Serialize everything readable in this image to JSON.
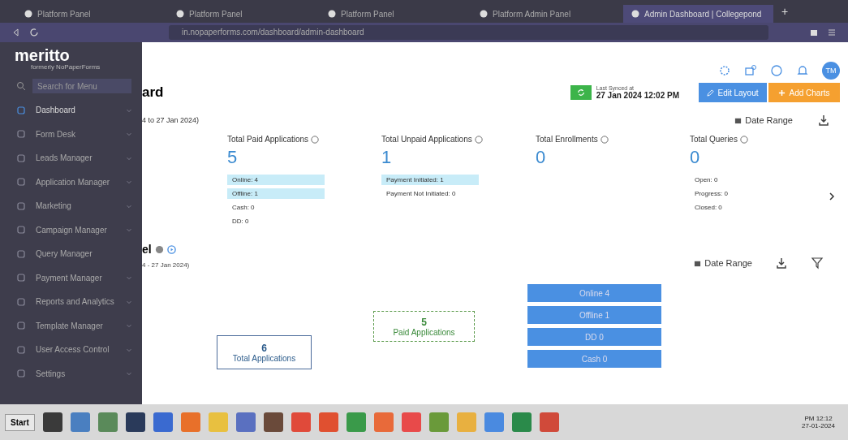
{
  "browser": {
    "tabs": [
      {
        "title": "Platform Panel",
        "selected": false
      },
      {
        "title": "Platform Panel",
        "selected": false
      },
      {
        "title": "Platform Panel",
        "selected": false
      },
      {
        "title": "Platform Admin Panel",
        "selected": false
      },
      {
        "title": "Admin Dashboard | Collegepond",
        "selected": true
      }
    ],
    "new_tab": "+",
    "url": "in.nopaperforms.com/dashboard/admin-dashboard"
  },
  "sidebar": {
    "logo": "meritto",
    "tagline": "formerly NoPaperForms",
    "search": {
      "placeholder": "Search for Menu"
    },
    "items": [
      {
        "label": "Dashboard",
        "selected": true,
        "has_submenu": true
      },
      {
        "label": "Form Desk",
        "selected": false,
        "has_submenu": true
      },
      {
        "label": "Leads Manager",
        "selected": false,
        "has_submenu": true
      },
      {
        "label": "Application Manager",
        "selected": false,
        "has_submenu": true
      },
      {
        "label": "Marketing",
        "selected": false,
        "has_submenu": true
      },
      {
        "label": "Campaign Manager",
        "selected": false,
        "has_submenu": true
      },
      {
        "label": "Query Manager",
        "selected": false,
        "has_submenu": false
      },
      {
        "label": "Payment Manager",
        "selected": false,
        "has_submenu": true
      },
      {
        "label": "Reports and Analytics",
        "selected": false,
        "has_submenu": true
      },
      {
        "label": "Template Manager",
        "selected": false,
        "has_submenu": true
      },
      {
        "label": "User Access Control",
        "selected": false,
        "has_submenu": true
      },
      {
        "label": "Settings",
        "selected": false,
        "has_submenu": true
      }
    ]
  },
  "header": {
    "avatar": "TM",
    "title": "ard",
    "last_synced_label": "Last Synced at",
    "last_synced": "27 Jan 2024 12:02 PM",
    "edit_layout": "Edit Layout",
    "add_charts": "Add Charts"
  },
  "summary": {
    "period": "4 to 27 Jan 2024)",
    "date_range": "Date Range",
    "cards": [
      {
        "title": "Total Paid Applications",
        "value": "5",
        "lines": [
          {
            "text": "Online: 4",
            "highlighted": true
          },
          {
            "text": "Offline: 1",
            "highlighted": true
          },
          {
            "text": "Cash: 0",
            "highlighted": false
          },
          {
            "text": "DD: 0",
            "highlighted": false
          }
        ]
      },
      {
        "title": "Total Unpaid Applications",
        "value": "1",
        "lines": [
          {
            "text": "Payment Initiated: 1",
            "highlighted": true
          },
          {
            "text": "Payment Not Initiated: 0",
            "highlighted": false
          }
        ]
      },
      {
        "title": "Total Enrollments",
        "value": "0"
      },
      {
        "title": "Total Queries",
        "value": "0",
        "lines": [
          {
            "text": "Open: 0",
            "highlighted": false
          },
          {
            "text": "Progress: 0",
            "highlighted": false
          },
          {
            "text": "Closed: 0",
            "highlighted": false
          }
        ]
      }
    ]
  },
  "funnel": {
    "title": "el",
    "period": "4 - 27 Jan 2024)",
    "date_range": "Date Range",
    "total": {
      "value": "6",
      "label": "Total Applications"
    },
    "paid": {
      "value": "5",
      "label": "Paid Applications"
    },
    "modes": [
      "Online 4",
      "Offline 1",
      "DD 0",
      "Cash 0"
    ]
  },
  "taskbar": {
    "start": "Start",
    "apps": [
      {
        "color": "#3a3a3a"
      },
      {
        "color": "#4a7fc0"
      },
      {
        "color": "#5a8a5a"
      },
      {
        "color": "#2a3a5a"
      },
      {
        "color": "#3a6ad0"
      },
      {
        "color": "#e8702a"
      },
      {
        "color": "#e8c040"
      },
      {
        "color": "#5a70c0"
      },
      {
        "color": "#6a4a3a"
      },
      {
        "color": "#e04a3a"
      },
      {
        "color": "#e05030"
      },
      {
        "color": "#3a9a4a"
      },
      {
        "color": "#e86a3a"
      },
      {
        "color": "#e84a4a"
      },
      {
        "color": "#6a9a3a"
      },
      {
        "color": "#e8b040"
      },
      {
        "color": "#4a8ae0"
      },
      {
        "color": "#2a8a4a"
      },
      {
        "color": "#d04a3a"
      }
    ],
    "time": "PM 12:12",
    "date": "27-01-2024"
  }
}
